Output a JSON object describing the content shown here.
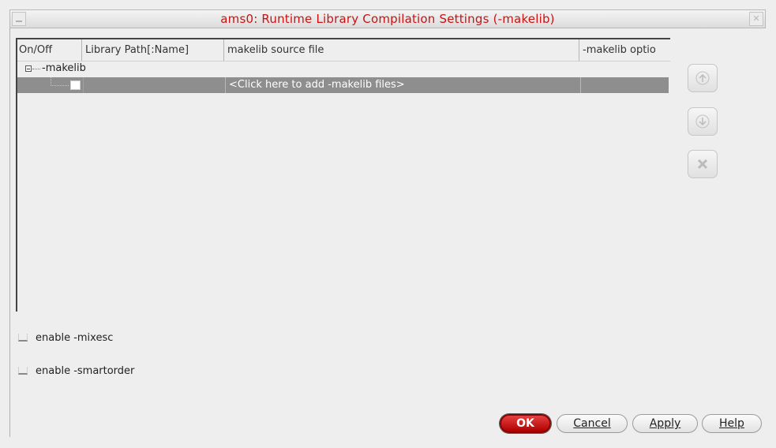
{
  "window": {
    "title": "ams0: Runtime Library Compilation Settings (-makelib)"
  },
  "table": {
    "columns": [
      "On/Off",
      "Library Path[:Name]",
      "makelib source file",
      "-makelib optio"
    ],
    "tree_root_label": "-makelib",
    "add_row_text": "<Click here to add -makelib files>"
  },
  "side_buttons": {
    "move_up_icon": "arrow-up",
    "move_down_icon": "arrow-down",
    "delete_icon": "x-mark"
  },
  "options": {
    "mixesc_label": "enable -mixesc",
    "smartorder_label": "enable -smartorder"
  },
  "buttons": {
    "ok": "OK",
    "cancel": "Cancel",
    "apply": "Apply",
    "help": "Help"
  },
  "colors": {
    "title": "#cc1111",
    "ok_button": "#cc1111",
    "selected_row": "#8e8e8e"
  }
}
